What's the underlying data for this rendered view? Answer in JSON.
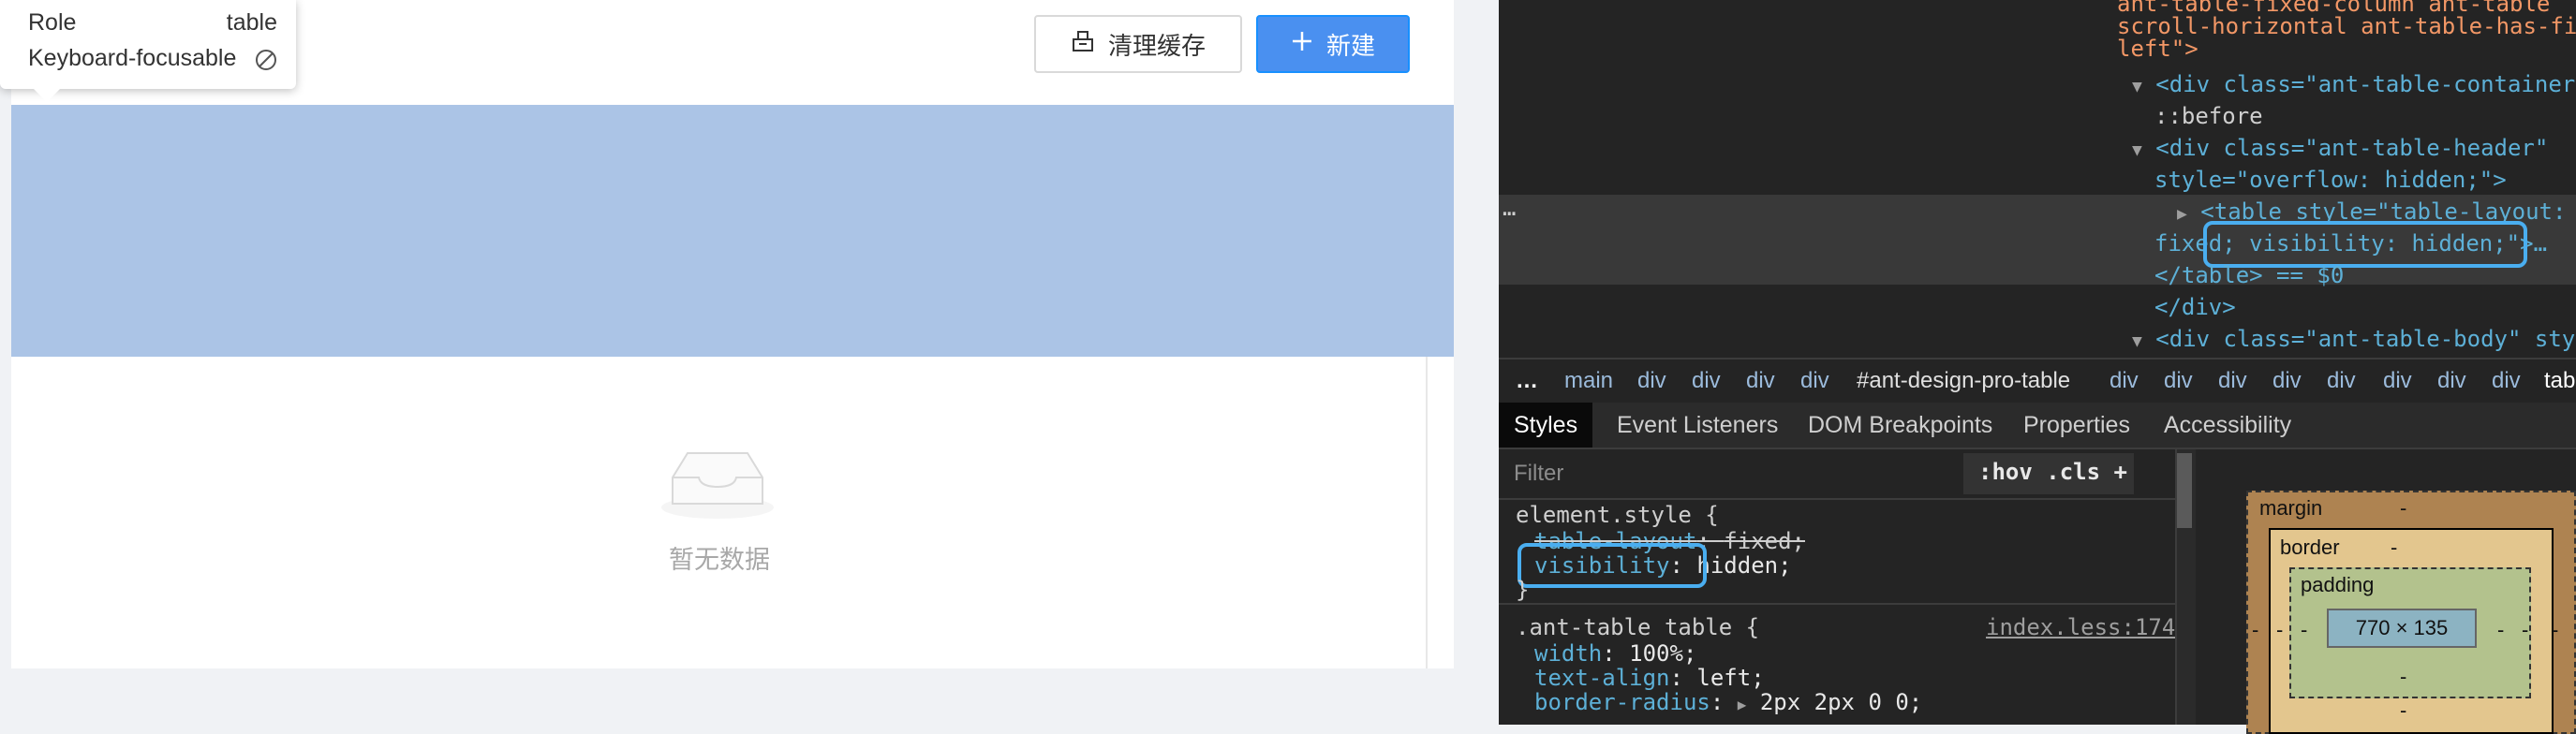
{
  "tooltip": {
    "role_label": "Role",
    "role_value": "table",
    "focus_label": "Keyboard-focusable"
  },
  "toolbar": {
    "clear_cache_label": "清理缓存",
    "new_label": "新建"
  },
  "empty": {
    "text": "暂无数据"
  },
  "devtools": {
    "dom_lines": [
      "ant-table-fixed-column ant-table",
      "scroll-horizontal ant-table-has-fix-",
      "left\">",
      "<div class=\"ant-table-container\">",
      "::before",
      "<div class=\"ant-table-header\"",
      "style=\"overflow: hidden;\">",
      "<table style=\"table-layout:",
      "fixed; visibility: hidden;\">…",
      "</table> == $0",
      "</div>",
      "<div class=\"ant-table-body\" style"
    ],
    "breadcrumb": [
      "…",
      "main",
      "div",
      "div",
      "div",
      "div",
      "#ant-design-pro-table",
      "div",
      "div",
      "div",
      "div",
      "div",
      "div",
      "div",
      "div",
      "tab"
    ],
    "tabs": [
      "Styles",
      "Event Listeners",
      "DOM Breakpoints",
      "Properties",
      "Accessibility"
    ],
    "active_tab": "Styles",
    "filter_placeholder": "Filter",
    "filter_tools": ":hov .cls +",
    "styles": {
      "element_style_selector": "element.style {",
      "prop1_name": "table-layout",
      "prop1_value": "fixed;",
      "prop2_name": "visibility",
      "prop2_value": "hidden;",
      "close": "}",
      "rule_selector": ".ant-table table {",
      "rule_source": "index.less:174",
      "rule_props": [
        {
          "name": "width",
          "value": "100%;"
        },
        {
          "name": "text-align",
          "value": "left;"
        },
        {
          "name": "border-radius",
          "value": "2px 2px 0 0;"
        }
      ]
    },
    "box_model": {
      "margin_label": "margin",
      "border_label": "border",
      "padding_label": "padding",
      "content_size": "770 × 135",
      "dash": "-"
    }
  },
  "colors": {
    "primary_button": "#4a90f0",
    "highlight": "#abc4e6",
    "callout": "#4aaef0"
  }
}
